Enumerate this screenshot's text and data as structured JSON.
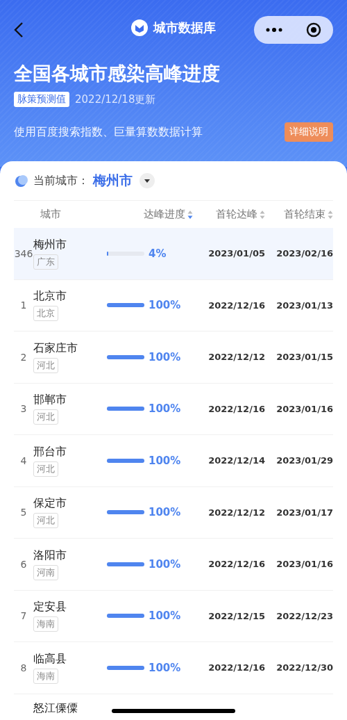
{
  "nav": {
    "title": "城市数据库"
  },
  "header": {
    "title": "全国各城市感染高峰进度",
    "badge": "脉策预测值",
    "updated": "2022/12/18更新",
    "description": "使用百度搜索指数、巨量算数数据计算",
    "detail_button": "详细说明"
  },
  "current_city": {
    "label": "当前城市：",
    "value": "梅州市"
  },
  "table": {
    "columns": [
      {
        "label": "城市",
        "sortable": false
      },
      {
        "label": "达峰进度",
        "sortable": true,
        "sorted": true
      },
      {
        "label": "首轮达峰",
        "sortable": true,
        "sorted": false
      },
      {
        "label": "首轮结束",
        "sortable": true,
        "sorted": false
      }
    ],
    "rows": [
      {
        "rank": "346",
        "city": "梅州市",
        "province": "广东",
        "level": 0.04,
        "percent": "4%",
        "peak": "2023/01/05",
        "end": "2023/02/16",
        "selected": true
      },
      {
        "rank": "1",
        "city": "北京市",
        "province": "北京",
        "level": 1,
        "percent": "100%",
        "peak": "2022/12/16",
        "end": "2023/01/13",
        "selected": false
      },
      {
        "rank": "2",
        "city": "石家庄市",
        "province": "河北",
        "level": 1,
        "percent": "100%",
        "peak": "2022/12/12",
        "end": "2023/01/15",
        "selected": false
      },
      {
        "rank": "3",
        "city": "邯郸市",
        "province": "河北",
        "level": 1,
        "percent": "100%",
        "peak": "2022/12/16",
        "end": "2023/01/16",
        "selected": false
      },
      {
        "rank": "4",
        "city": "邢台市",
        "province": "河北",
        "level": 1,
        "percent": "100%",
        "peak": "2022/12/14",
        "end": "2023/01/29",
        "selected": false
      },
      {
        "rank": "5",
        "city": "保定市",
        "province": "河北",
        "level": 1,
        "percent": "100%",
        "peak": "2022/12/12",
        "end": "2023/01/17",
        "selected": false
      },
      {
        "rank": "6",
        "city": "洛阳市",
        "province": "河南",
        "level": 1,
        "percent": "100%",
        "peak": "2022/12/16",
        "end": "2023/01/16",
        "selected": false
      },
      {
        "rank": "7",
        "city": "定安县",
        "province": "海南",
        "level": 1,
        "percent": "100%",
        "peak": "2022/12/15",
        "end": "2022/12/23",
        "selected": false
      },
      {
        "rank": "8",
        "city": "临高县",
        "province": "海南",
        "level": 1,
        "percent": "100%",
        "peak": "2022/12/16",
        "end": "2022/12/30",
        "selected": false
      }
    ],
    "cut_row": {
      "city": "怒江傈僳"
    }
  }
}
